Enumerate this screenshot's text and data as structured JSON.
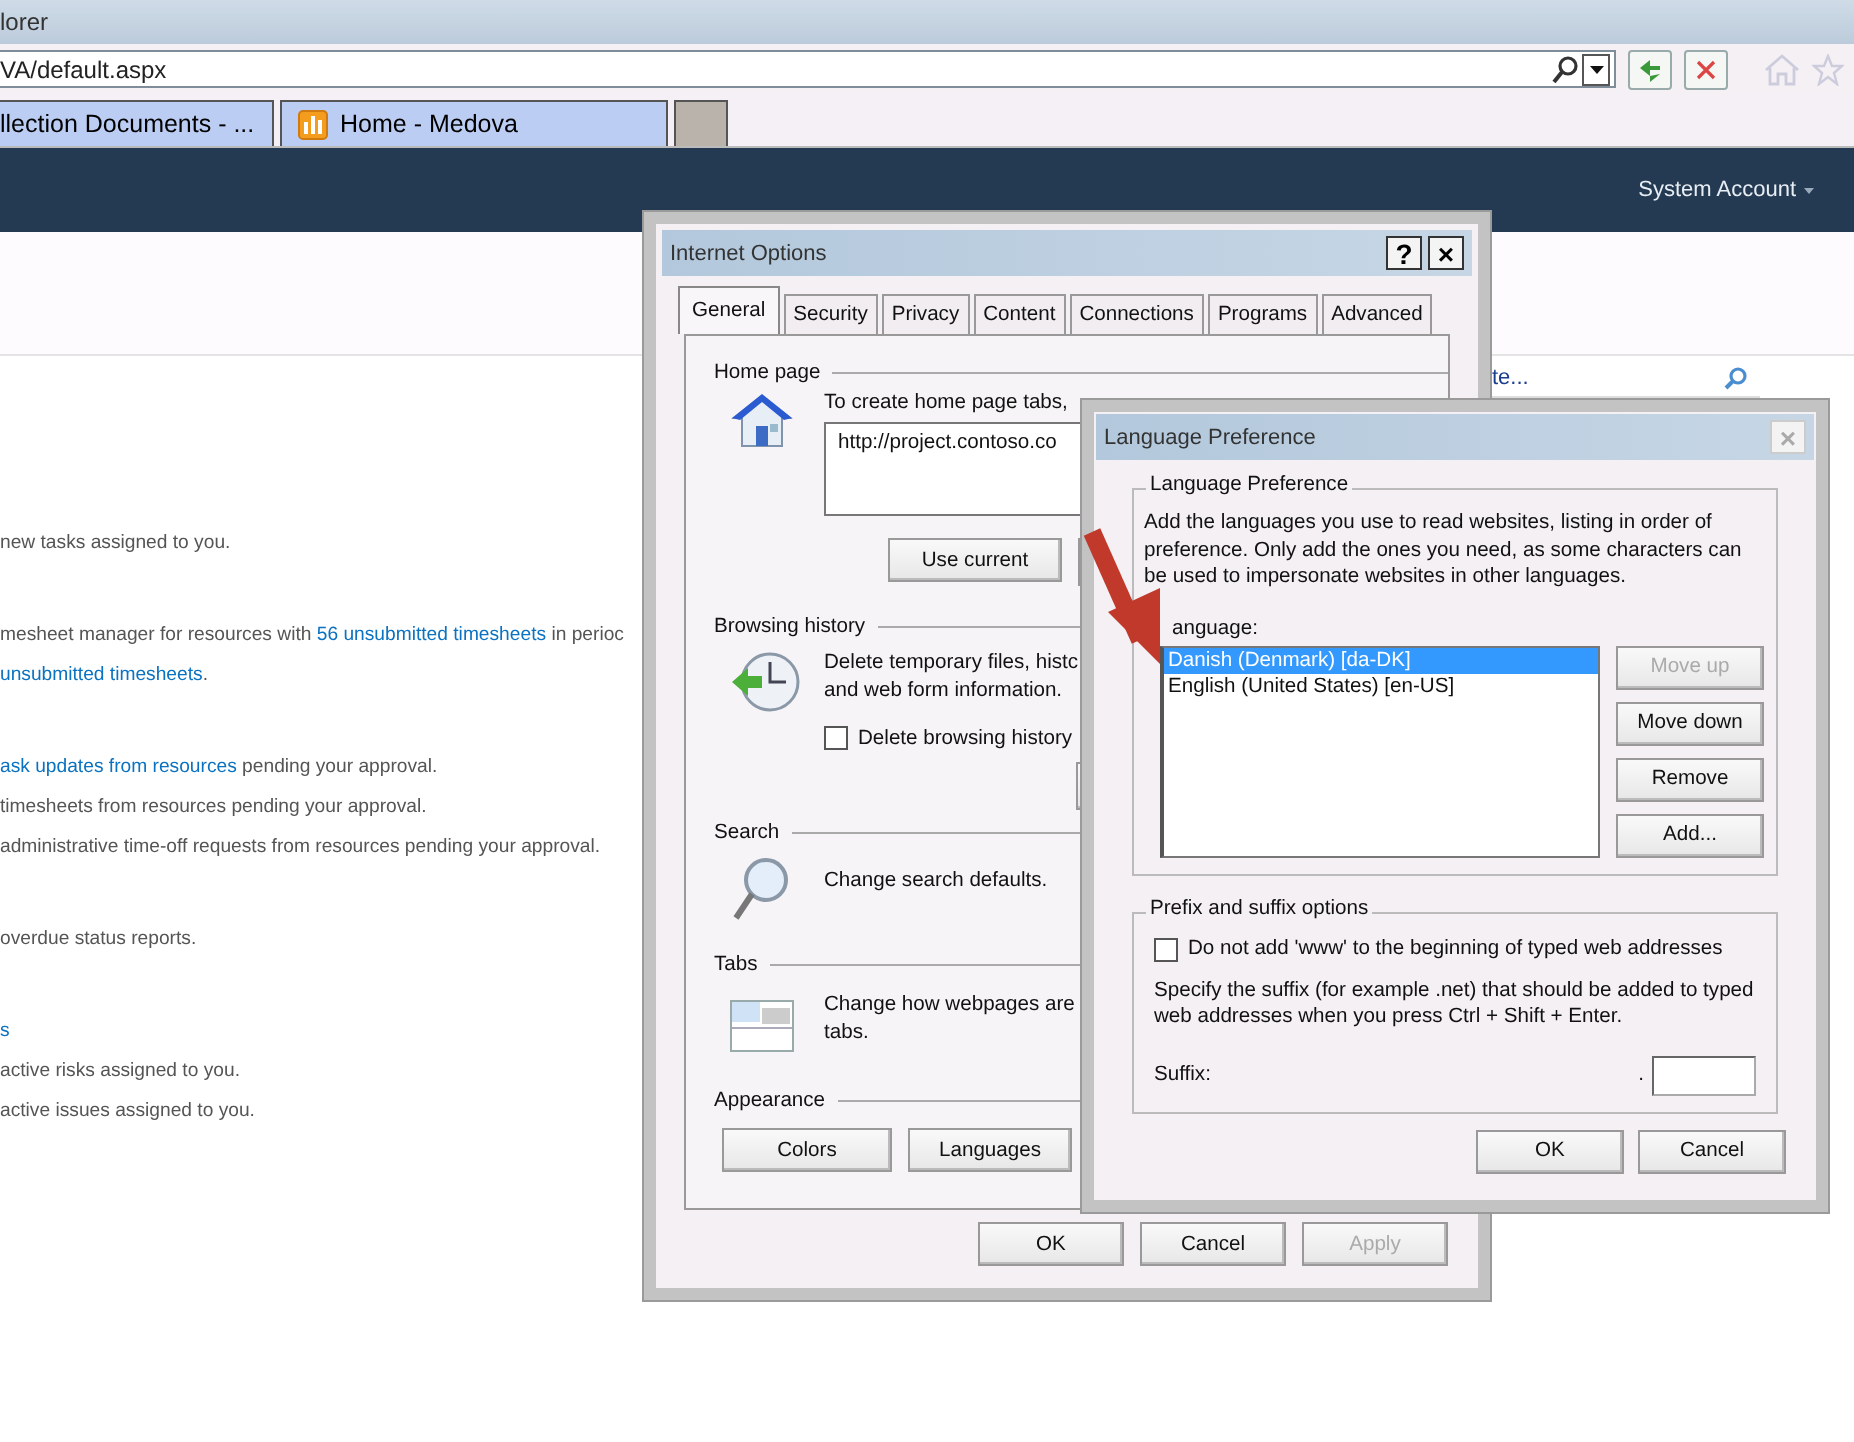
{
  "browser": {
    "title": "lorer",
    "address": "VA/default.aspx",
    "tabs": [
      {
        "label": "llection Documents - ...",
        "kind": "plain"
      },
      {
        "label": "Home - Medova",
        "kind": "app"
      }
    ]
  },
  "site": {
    "account": "System Account",
    "search_value": "te...",
    "groups": [
      {
        "lines": [
          [
            {
              "text": "new tasks assigned to you."
            }
          ]
        ]
      },
      {
        "lines": [
          [
            {
              "text": "mesheet manager for resources with "
            },
            {
              "text": "56 unsubmitted timesheets",
              "link": true
            },
            {
              "text": " in perioc"
            }
          ],
          [
            {
              "text": "unsubmitted timesheets",
              "link": true
            },
            {
              "text": "."
            }
          ]
        ]
      },
      {
        "lines": [
          [
            {
              "text": "ask updates from resources",
              "link": true
            },
            {
              "text": " pending your approval."
            }
          ],
          [
            {
              "text": " timesheets from resources pending your approval."
            }
          ],
          [
            {
              "text": " administrative time-off requests from resources pending your approval."
            }
          ]
        ]
      },
      {
        "lines": [
          [
            {
              "text": " overdue status reports."
            }
          ]
        ]
      },
      {
        "lines": [
          [
            {
              "text": "s",
              "link": true
            }
          ],
          [
            {
              "text": " active risks assigned to you."
            }
          ],
          [
            {
              "text": " active issues assigned to you."
            }
          ]
        ]
      }
    ]
  },
  "internet_options": {
    "title": "Internet Options",
    "help": "?",
    "close": "×",
    "tabs": [
      {
        "label": "General",
        "selected": true
      },
      {
        "label": "Security",
        "selected": false
      },
      {
        "label": "Privacy",
        "selected": false
      },
      {
        "label": "Content",
        "selected": false
      },
      {
        "label": "Connections",
        "selected": false
      },
      {
        "label": "Programs",
        "selected": false
      },
      {
        "label": "Advanced",
        "selected": false
      }
    ],
    "home_page": {
      "heading": "Home page",
      "text": "To create home page tabs,",
      "url": "http://project.contoso.co",
      "button": "Use current"
    },
    "browsing_history": {
      "heading": "Browsing history",
      "lines": [
        "Delete temporary files, histc",
        "and web form information."
      ],
      "checkbox": {
        "label": "Delete browsing history",
        "checked": false
      }
    },
    "search": {
      "heading": "Search",
      "lines": [
        "Change search defaults."
      ]
    },
    "tabs_section": {
      "heading": "Tabs",
      "lines": [
        "Change how webpages are",
        "tabs."
      ]
    },
    "appearance": {
      "heading": "Appearance",
      "buttons": [
        "Colors",
        "Languages"
      ]
    },
    "buttons": [
      {
        "label": "OK",
        "disabled": false
      },
      {
        "label": "Cancel",
        "disabled": false
      },
      {
        "label": "Apply",
        "disabled": true
      }
    ]
  },
  "language_preference": {
    "title": "Language Preference",
    "group": "Language Preference",
    "description": "Add the languages you use to read websites, listing in order of preference. Only add the ones you need, as some characters can be used to impersonate websites in other languages.",
    "list_label": "anguage:",
    "languages": [
      {
        "name": "Danish (Denmark) [da-DK]",
        "selected": true
      },
      {
        "name": "English (United States) [en-US]",
        "selected": false
      }
    ],
    "list_buttons": [
      {
        "label": "Move up",
        "disabled": true
      },
      {
        "label": "Move down",
        "disabled": false
      },
      {
        "label": "Remove",
        "disabled": false
      },
      {
        "label": "Add...",
        "disabled": false
      }
    ],
    "prefix_group": "Prefix and suffix options",
    "checkbox": {
      "label": "Do not add 'www' to the beginning of typed web addresses",
      "checked": false
    },
    "suffix_text": "Specify the suffix (for example .net) that should be added to typed web addresses when you press Ctrl + Shift + Enter.",
    "suffix_label": "Suffix:",
    "suffix_dot": ".",
    "buttons": [
      {
        "label": "OK",
        "disabled": false
      },
      {
        "label": "Cancel",
        "disabled": false
      }
    ]
  }
}
